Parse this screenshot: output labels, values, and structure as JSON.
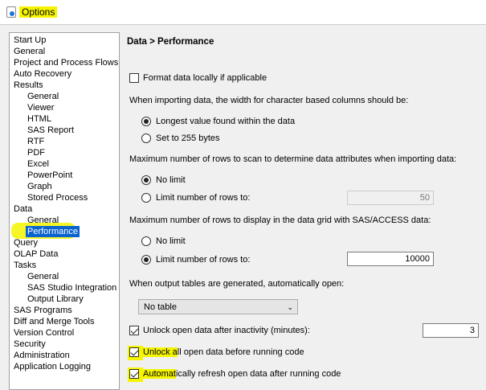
{
  "window": {
    "title": "Options"
  },
  "tree": [
    {
      "label": "Start Up",
      "child": false
    },
    {
      "label": "General",
      "child": false
    },
    {
      "label": "Project and Process Flows",
      "child": false
    },
    {
      "label": "Auto Recovery",
      "child": false
    },
    {
      "label": "Results",
      "child": false
    },
    {
      "label": "General",
      "child": true
    },
    {
      "label": "Viewer",
      "child": true
    },
    {
      "label": "HTML",
      "child": true
    },
    {
      "label": "SAS Report",
      "child": true
    },
    {
      "label": "RTF",
      "child": true
    },
    {
      "label": "PDF",
      "child": true
    },
    {
      "label": "Excel",
      "child": true
    },
    {
      "label": "PowerPoint",
      "child": true
    },
    {
      "label": "Graph",
      "child": true
    },
    {
      "label": "Stored Process",
      "child": true
    },
    {
      "label": "Data",
      "child": false
    },
    {
      "label": "General",
      "child": true
    },
    {
      "label": "Performance",
      "child": true,
      "selected": true
    },
    {
      "label": "Query",
      "child": false
    },
    {
      "label": "OLAP Data",
      "child": false
    },
    {
      "label": "Tasks",
      "child": false
    },
    {
      "label": "General",
      "child": true
    },
    {
      "label": "SAS Studio Integration",
      "child": true
    },
    {
      "label": "Output Library",
      "child": true
    },
    {
      "label": "SAS Programs",
      "child": false
    },
    {
      "label": "Diff and Merge Tools",
      "child": false
    },
    {
      "label": "Version Control",
      "child": false
    },
    {
      "label": "Security",
      "child": false
    },
    {
      "label": "Administration",
      "child": false
    },
    {
      "label": "Application Logging",
      "child": false
    }
  ],
  "panel": {
    "heading": "Data > Performance",
    "format_local": {
      "label": "Format data locally if applicable",
      "checked": false
    },
    "width_q": "When importing data, the width for character based columns should be:",
    "width_opt1": "Longest value found within the data",
    "width_opt2": "Set to 255 bytes",
    "scan_q": "Maximum number of rows to scan to determine data attributes when importing data:",
    "scan_opt1": "No limit",
    "scan_opt2": "Limit number of rows to:",
    "scan_value": "50",
    "display_q": "Maximum number of rows to display in the data grid with SAS/ACCESS data:",
    "display_opt1": "No limit",
    "display_opt2": "Limit number of rows to:",
    "display_value": "10000",
    "open_q": "When output tables are generated, automatically open:",
    "open_value": "No table",
    "unlock_inactive": {
      "label": "Unlock open data after inactivity (minutes):",
      "value": "3"
    },
    "unlock_all_a": "Unlock a",
    "unlock_all_b": "ll open data before running code",
    "refresh_a": "Automat",
    "refresh_b": "ically refresh open data after running code"
  }
}
